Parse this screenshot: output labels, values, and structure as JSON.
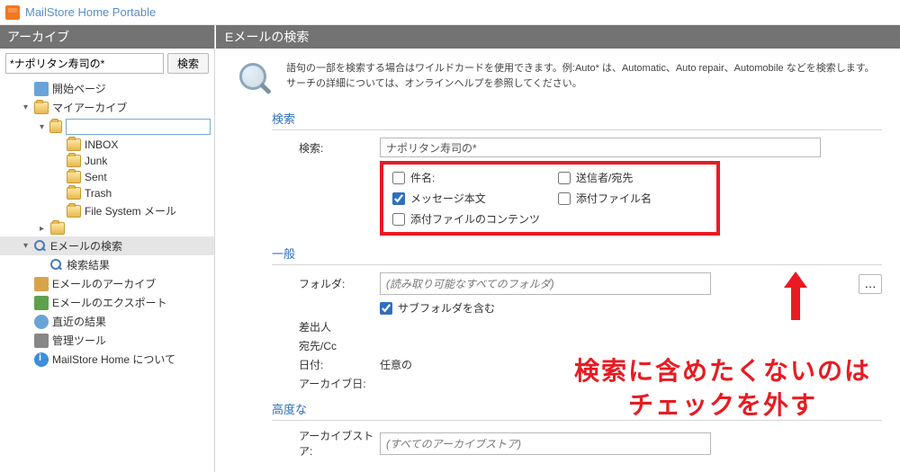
{
  "app": {
    "title": "MailStore Home Portable"
  },
  "sidebar": {
    "header": "アーカイブ",
    "search_value": "*ナポリタン寿司の*",
    "search_btn": "検索",
    "items": [
      {
        "label": "開始ページ",
        "icon": "start",
        "depth": 1,
        "arrow": ""
      },
      {
        "label": "マイアーカイブ",
        "icon": "folder",
        "depth": 1,
        "arrow": "▾"
      },
      {
        "label": "",
        "icon": "folder",
        "depth": 2,
        "arrow": "▾",
        "edit": true
      },
      {
        "label": "INBOX",
        "icon": "folder",
        "depth": 3,
        "arrow": ""
      },
      {
        "label": "Junk",
        "icon": "folder",
        "depth": 3,
        "arrow": ""
      },
      {
        "label": "Sent",
        "icon": "folder",
        "depth": 3,
        "arrow": ""
      },
      {
        "label": "Trash",
        "icon": "folder",
        "depth": 3,
        "arrow": ""
      },
      {
        "label": "File System メール",
        "icon": "folder",
        "depth": 3,
        "arrow": ""
      },
      {
        "label": "",
        "icon": "folder",
        "depth": 2,
        "arrow": "▸"
      },
      {
        "label": "Eメールの検索",
        "icon": "mag",
        "depth": 1,
        "arrow": "▾",
        "selected": true
      },
      {
        "label": "検索結果",
        "icon": "mag",
        "depth": 2,
        "arrow": ""
      },
      {
        "label": "Eメールのアーカイブ",
        "icon": "archive",
        "depth": 1,
        "arrow": ""
      },
      {
        "label": "Eメールのエクスポート",
        "icon": "export",
        "depth": 1,
        "arrow": ""
      },
      {
        "label": "直近の結果",
        "icon": "clock",
        "depth": 1,
        "arrow": ""
      },
      {
        "label": "管理ツール",
        "icon": "tool",
        "depth": 1,
        "arrow": ""
      },
      {
        "label": "MailStore Home について",
        "icon": "info",
        "depth": 1,
        "arrow": ""
      }
    ]
  },
  "content": {
    "header": "Eメールの検索",
    "help": "語句の一部を検索する場合はワイルドカードを使用できます。例:Auto* は、Automatic、Auto repair、Automobile などを検索します。サーチの詳細については、オンラインヘルプを参照してください。",
    "sec_search": "検索",
    "label_keyword": "検索:",
    "keyword_value": "ナポリタン寿司の*",
    "checks": {
      "subject": "件名:",
      "sender": "送信者/宛先",
      "body": "メッセージ本文",
      "attachname": "添付ファイル名",
      "attachcontent": "添付ファイルのコンテンツ"
    },
    "sec_general": "一般",
    "label_folder": "フォルダ:",
    "folder_value": "(読み取り可能なすべてのフォルダ)",
    "subfolder": "サブフォルダを含む",
    "label_from": "差出人",
    "label_to": "宛先/Cc",
    "label_date": "日付:",
    "date_value": "任意の",
    "label_archdate": "アーカイブ日:",
    "sec_advanced": "高度な",
    "label_store": "アーカイブストア:",
    "store_value": "(すべてのアーカイブストア)"
  },
  "annotation": {
    "line1": "検索に含めたくないのは",
    "line2": "チェックを外す"
  }
}
